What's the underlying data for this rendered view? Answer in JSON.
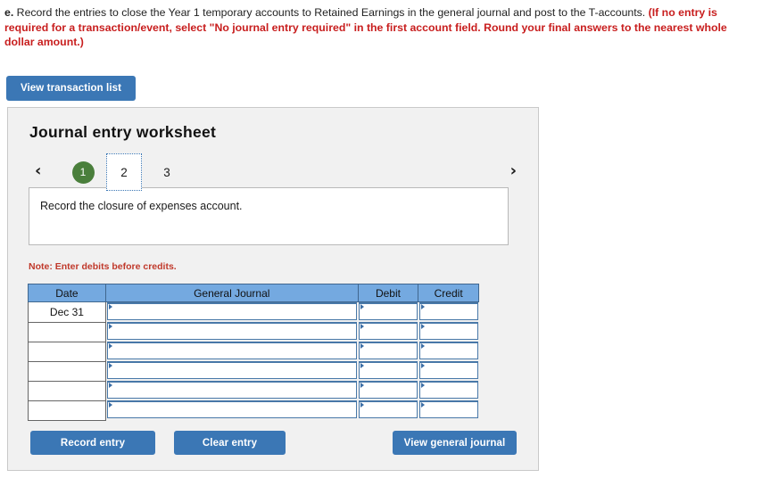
{
  "question": {
    "label": "e.",
    "text_normal": " Record the entries to close the Year 1 temporary accounts to Retained Earnings in the general journal and post to the T-accounts. ",
    "text_warning": "(If no entry is required for a transaction/event, select \"No journal entry required\" in the first account field. Round your final answers to the nearest whole dollar amount.)"
  },
  "toolbar": {
    "view_transaction_list_label": "View transaction list"
  },
  "worksheet": {
    "title": "Journal entry worksheet",
    "nav": {
      "prev_icon": "‹",
      "next_icon": "›"
    },
    "tabs": [
      {
        "label": "1",
        "state": "completed"
      },
      {
        "label": "2",
        "state": "active"
      },
      {
        "label": "3",
        "state": "inactive"
      }
    ],
    "prompt": "Record the closure of expenses account.",
    "note": "Note: Enter debits before credits.",
    "table": {
      "headers": [
        "Date",
        "General Journal",
        "Debit",
        "Credit"
      ],
      "rows": [
        {
          "date": "Dec 31",
          "general_journal": "",
          "debit": "",
          "credit": ""
        },
        {
          "date": "",
          "general_journal": "",
          "debit": "",
          "credit": ""
        },
        {
          "date": "",
          "general_journal": "",
          "debit": "",
          "credit": ""
        },
        {
          "date": "",
          "general_journal": "",
          "debit": "",
          "credit": ""
        },
        {
          "date": "",
          "general_journal": "",
          "debit": "",
          "credit": ""
        },
        {
          "date": "",
          "general_journal": "",
          "debit": "",
          "credit": ""
        }
      ]
    },
    "actions": {
      "record_entry_label": "Record entry",
      "clear_entry_label": "Clear entry",
      "view_general_journal_label": "View general journal"
    }
  },
  "colors": {
    "button_blue": "#3b77b5",
    "table_header_blue": "#74a9e0",
    "completed_tab_green": "#4a7f3c",
    "warning_red": "#c81e1e",
    "note_red": "#c0392b",
    "panel_bg": "#f1f1f1"
  }
}
